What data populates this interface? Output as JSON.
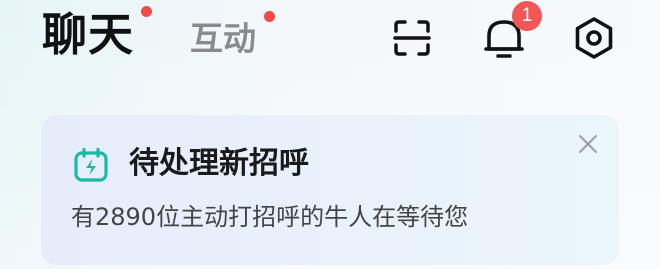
{
  "header": {
    "tabs": [
      {
        "label": "聊天",
        "active": true,
        "has_dot": true
      },
      {
        "label": "互动",
        "active": false,
        "has_dot": true
      }
    ],
    "actions": [
      {
        "name": "scan",
        "icon": "scan-icon"
      },
      {
        "name": "notifications",
        "icon": "bell-icon",
        "badge": "1"
      },
      {
        "name": "settings",
        "icon": "settings-icon"
      }
    ]
  },
  "card": {
    "icon": "calendar-lightning-icon",
    "title": "待处理新招呼",
    "subtitle": "有2890位主动打招呼的牛人在等待您",
    "close_icon": "close-icon"
  },
  "colors": {
    "accent_teal": "#1bb9a6",
    "badge_red": "#f25656",
    "dot_red": "#f04a4a",
    "text_primary": "#111111",
    "text_secondary": "#8a8a8a"
  }
}
